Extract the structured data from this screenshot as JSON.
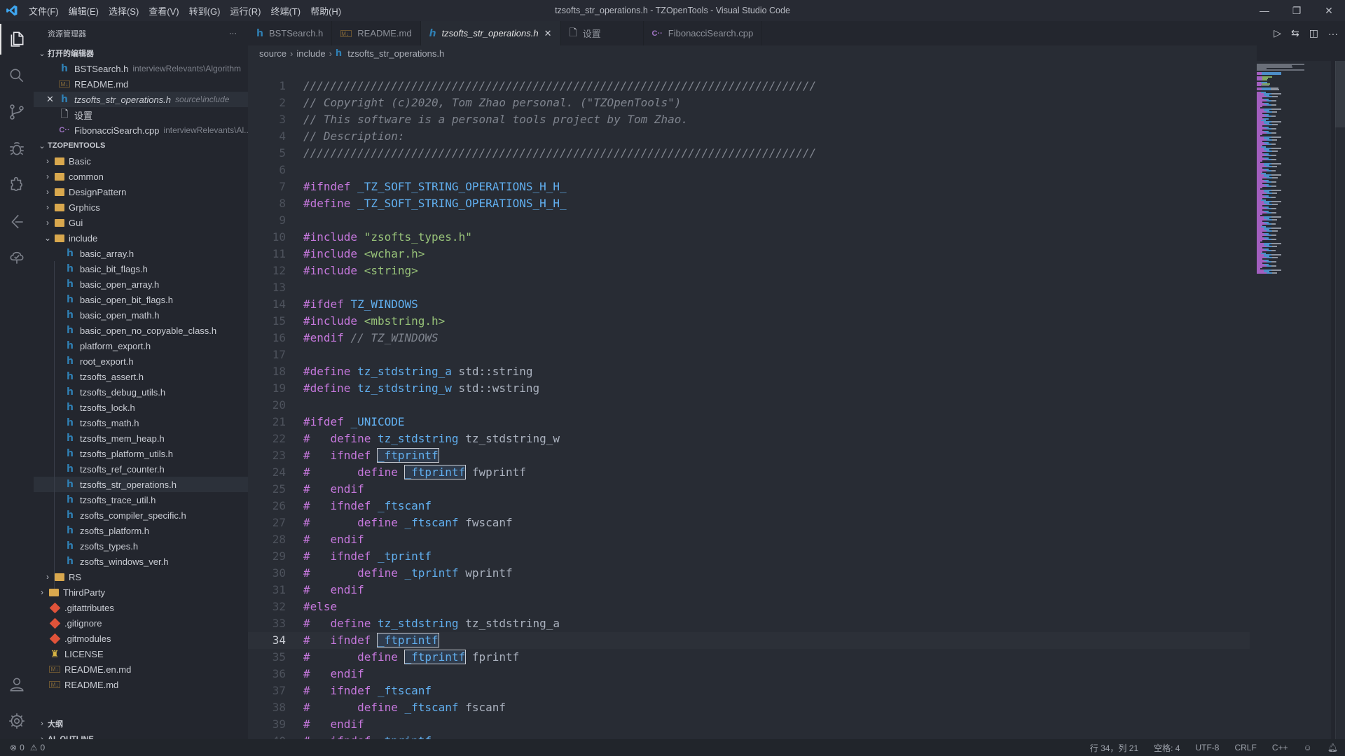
{
  "window": {
    "title": "tzsofts_str_operations.h - TZOpenTools - Visual Studio Code",
    "menu": [
      "文件(F)",
      "编辑(E)",
      "选择(S)",
      "查看(V)",
      "转到(G)",
      "运行(R)",
      "终端(T)",
      "帮助(H)"
    ],
    "controls": {
      "minimize": "—",
      "restore": "❐",
      "close": "✕"
    }
  },
  "activity_bar": {
    "items": [
      {
        "name": "explorer",
        "icon": "files-icon",
        "active": true
      },
      {
        "name": "search",
        "icon": "search-icon"
      },
      {
        "name": "source-control",
        "icon": "source-control-icon"
      },
      {
        "name": "debug",
        "icon": "debug-icon"
      },
      {
        "name": "extensions",
        "icon": "extensions-icon"
      },
      {
        "name": "remote",
        "icon": "remote-icon"
      },
      {
        "name": "tree",
        "icon": "tree-icon"
      }
    ],
    "bottom": [
      {
        "name": "accounts",
        "icon": "account-icon"
      },
      {
        "name": "manage",
        "icon": "gear-icon"
      }
    ]
  },
  "sidebar": {
    "title": "资源管理器",
    "more": "···",
    "open_editors": {
      "label": "打开的编辑器",
      "items": [
        {
          "name": "BSTSearch.h",
          "desc": "interviewRelevants\\Algorithm",
          "icon": "h"
        },
        {
          "name": "README.md",
          "desc": "",
          "icon": "md"
        },
        {
          "name": "tzsofts_str_operations.h",
          "desc": "source\\include",
          "icon": "h",
          "active": true,
          "close": "✕"
        },
        {
          "name": "设置",
          "desc": "",
          "icon": "file"
        },
        {
          "name": "FibonacciSearch.cpp",
          "desc": "interviewRelevants\\Al...",
          "icon": "cpp"
        }
      ]
    },
    "workspace": {
      "label": "TZOPENTOOLS",
      "folders_top": [
        "Basic",
        "common",
        "DesignPattern",
        "Grphics",
        "Gui"
      ],
      "include_folder": "include",
      "include_files": [
        "basic_array.h",
        "basic_bit_flags.h",
        "basic_open_array.h",
        "basic_open_bit_flags.h",
        "basic_open_math.h",
        "basic_open_no_copyable_class.h",
        "platform_export.h",
        "root_export.h",
        "tzsofts_assert.h",
        "tzsofts_debug_utils.h",
        "tzsofts_lock.h",
        "tzsofts_math.h",
        "tzsofts_mem_heap.h",
        "tzsofts_platform_utils.h",
        "tzsofts_ref_counter.h",
        "tzsofts_str_operations.h",
        "tzsofts_trace_util.h",
        "zsofts_compiler_specific.h",
        "zsofts_platform.h",
        "zsofts_types.h",
        "zsofts_windows_ver.h"
      ],
      "selected_file": "tzsofts_str_operations.h",
      "folder_rs": "RS",
      "folder_thirdparty": "ThirdParty",
      "root_files": [
        {
          "name": ".gitattributes",
          "icon": "git"
        },
        {
          "name": ".gitignore",
          "icon": "git"
        },
        {
          "name": ".gitmodules",
          "icon": "git"
        },
        {
          "name": "LICENSE",
          "icon": "license"
        },
        {
          "name": "README.en.md",
          "icon": "md"
        },
        {
          "name": "README.md",
          "icon": "md"
        }
      ]
    },
    "outline_label": "大纲",
    "al_outline_label": "AL OUTLINE"
  },
  "tabs": [
    {
      "label": "BSTSearch.h",
      "icon": "h"
    },
    {
      "label": "README.md",
      "icon": "md"
    },
    {
      "label": "tzsofts_str_operations.h",
      "icon": "h",
      "active": true,
      "close": "✕"
    },
    {
      "label": "设置",
      "icon": "file"
    },
    {
      "label": "FibonacciSearch.cpp",
      "icon": "cpp"
    }
  ],
  "editor_actions": {
    "run": "▷",
    "compare": "⇆",
    "split": "◫",
    "more": "···"
  },
  "breadcrumb": [
    "source",
    "include",
    "tzsofts_str_operations.h"
  ],
  "breadcrumb_sep": "›",
  "code": {
    "current_line": 34,
    "lines": [
      [
        [
          "com",
          "////////////////////////////////////////////////////////////////////////////"
        ]
      ],
      [
        [
          "com",
          "// Copyright (c)2020, Tom Zhao personal. (\"TZOpenTools\")"
        ]
      ],
      [
        [
          "com",
          "// This software is a personal tools project by Tom Zhao."
        ]
      ],
      [
        [
          "com",
          "// Description:"
        ]
      ],
      [
        [
          "com",
          "////////////////////////////////////////////////////////////////////////////"
        ]
      ],
      [],
      [
        [
          "pp",
          "#ifndef "
        ],
        [
          "mac",
          "_TZ_SOFT_STRING_OPERATIONS_H_H_"
        ]
      ],
      [
        [
          "pp",
          "#define "
        ],
        [
          "mac",
          "_TZ_SOFT_STRING_OPERATIONS_H_H_"
        ]
      ],
      [],
      [
        [
          "pp",
          "#include "
        ],
        [
          "str",
          "\"zsofts_types.h\""
        ]
      ],
      [
        [
          "pp",
          "#include "
        ],
        [
          "str",
          "<wchar.h>"
        ]
      ],
      [
        [
          "pp",
          "#include "
        ],
        [
          "str",
          "<string>"
        ]
      ],
      [],
      [
        [
          "pp",
          "#ifdef "
        ],
        [
          "mac",
          "TZ_WINDOWS"
        ]
      ],
      [
        [
          "pp",
          "#include "
        ],
        [
          "str",
          "<mbstring.h>"
        ]
      ],
      [
        [
          "pp",
          "#endif "
        ],
        [
          "com",
          "// TZ_WINDOWS"
        ]
      ],
      [],
      [
        [
          "pp",
          "#define "
        ],
        [
          "mac",
          "tz_stdstring_a"
        ],
        [
          "txt",
          " std::string"
        ]
      ],
      [
        [
          "pp",
          "#define "
        ],
        [
          "mac",
          "tz_stdstring_w"
        ],
        [
          "txt",
          " std::wstring"
        ]
      ],
      [],
      [
        [
          "pp",
          "#ifdef "
        ],
        [
          "mac",
          "_UNICODE"
        ]
      ],
      [
        [
          "pp",
          "#   define "
        ],
        [
          "mac",
          "tz_stdstring"
        ],
        [
          "txt",
          " tz_stdstring_w"
        ]
      ],
      [
        [
          "pp",
          "#   ifndef "
        ],
        [
          "box",
          "_ftprintf"
        ]
      ],
      [
        [
          "pp",
          "#       define "
        ],
        [
          "box",
          "_ftprintf"
        ],
        [
          "txt",
          " fwprintf"
        ]
      ],
      [
        [
          "pp",
          "#   endif"
        ]
      ],
      [
        [
          "pp",
          "#   ifndef "
        ],
        [
          "mac",
          "_ftscanf"
        ]
      ],
      [
        [
          "pp",
          "#       define "
        ],
        [
          "mac",
          "_ftscanf"
        ],
        [
          "txt",
          " fwscanf"
        ]
      ],
      [
        [
          "pp",
          "#   endif"
        ]
      ],
      [
        [
          "pp",
          "#   ifndef "
        ],
        [
          "mac",
          "_tprintf"
        ]
      ],
      [
        [
          "pp",
          "#       define "
        ],
        [
          "mac",
          "_tprintf"
        ],
        [
          "txt",
          " wprintf"
        ]
      ],
      [
        [
          "pp",
          "#   endif"
        ]
      ],
      [
        [
          "pp",
          "#else"
        ]
      ],
      [
        [
          "pp",
          "#   define "
        ],
        [
          "mac",
          "tz_stdstring"
        ],
        [
          "txt",
          " tz_stdstring_a"
        ]
      ],
      [
        [
          "pp",
          "#   ifndef "
        ],
        [
          "box",
          "_ftprintf"
        ]
      ],
      [
        [
          "pp",
          "#       define "
        ],
        [
          "box",
          "_ftprintf"
        ],
        [
          "txt",
          " fprintf"
        ]
      ],
      [
        [
          "pp",
          "#   endif"
        ]
      ],
      [
        [
          "pp",
          "#   ifndef "
        ],
        [
          "mac",
          "_ftscanf"
        ]
      ],
      [
        [
          "pp",
          "#       define "
        ],
        [
          "mac",
          "_ftscanf"
        ],
        [
          "txt",
          " fscanf"
        ]
      ],
      [
        [
          "pp",
          "#   endif"
        ]
      ],
      [
        [
          "pp",
          "#   ifndef "
        ],
        [
          "mac",
          "_tprintf"
        ]
      ]
    ]
  },
  "status_bar": {
    "errors": "0",
    "warnings": "0",
    "position": "行 34，列 21",
    "indent": "空格: 4",
    "encoding": "UTF-8",
    "eol": "CRLF",
    "language": "C++"
  }
}
